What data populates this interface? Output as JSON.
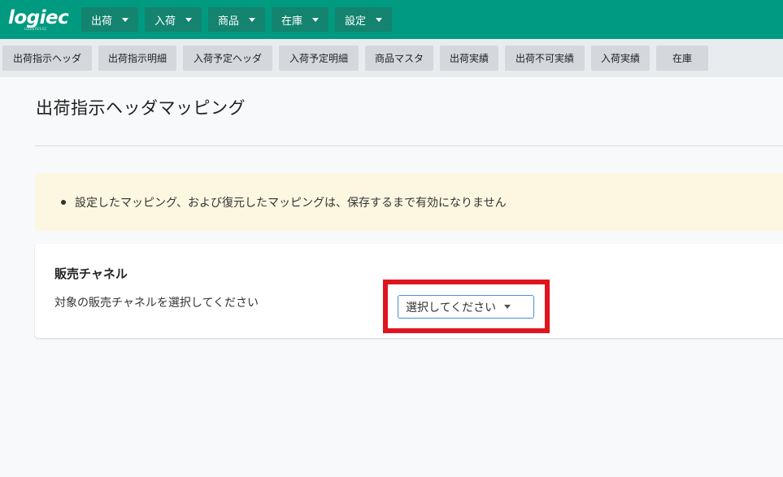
{
  "app": {
    "logo_text": "logiec",
    "logo_tagline": "LOGISTICS EC"
  },
  "top_nav": [
    {
      "label": "出荷"
    },
    {
      "label": "入荷"
    },
    {
      "label": "商品"
    },
    {
      "label": "在庫"
    },
    {
      "label": "設定"
    }
  ],
  "sub_nav": [
    {
      "label": "出荷指示ヘッダ"
    },
    {
      "label": "出荷指示明細"
    },
    {
      "label": "入荷予定ヘッダ"
    },
    {
      "label": "入荷予定明細"
    },
    {
      "label": "商品マスタ"
    },
    {
      "label": "出荷実績"
    },
    {
      "label": "出荷不可実績"
    },
    {
      "label": "入荷実績"
    },
    {
      "label": "在庫"
    }
  ],
  "page": {
    "title": "出荷指示ヘッダマッピング"
  },
  "alert": {
    "message": "設定したマッピング、および復元したマッピングは、保存するまで有効になりません"
  },
  "sales_channel": {
    "title": "販売チャネル",
    "description": "対象の販売チャネルを選択してください",
    "select_value": "選択してください"
  },
  "colors": {
    "header": "#009a80",
    "highlight": "#e0141e",
    "alert_bg": "#fdf7e1"
  }
}
